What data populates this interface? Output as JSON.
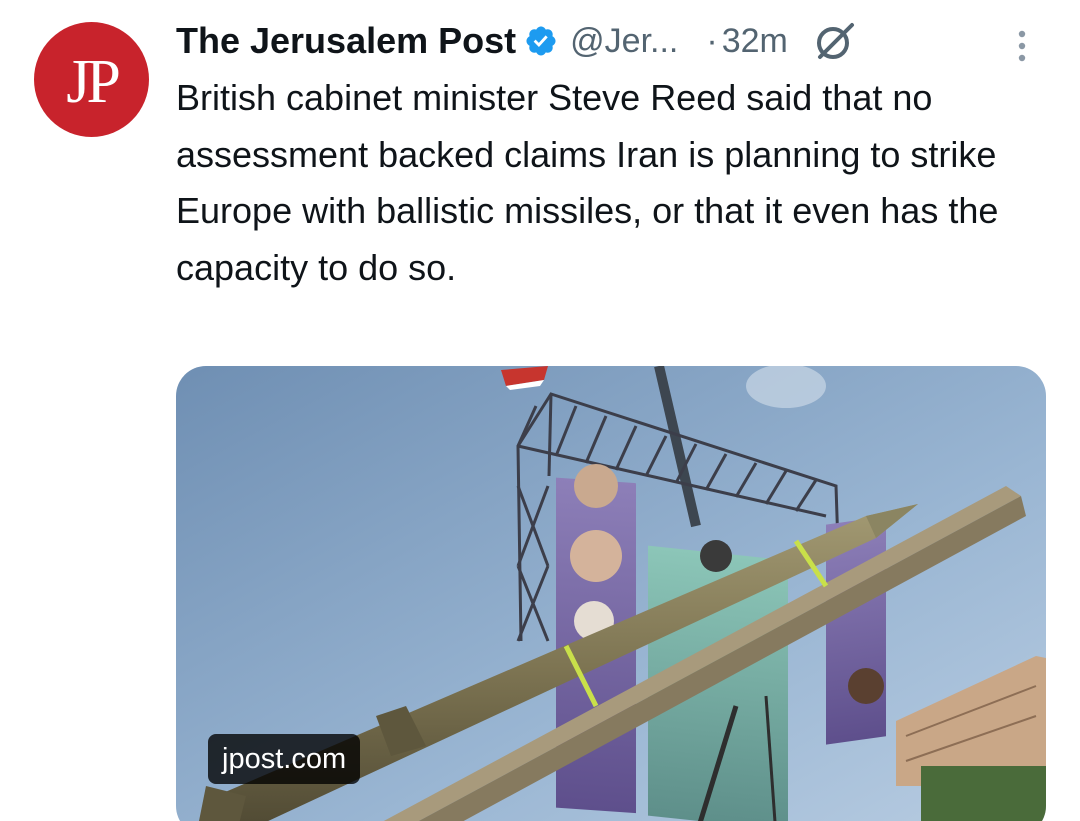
{
  "tweet": {
    "avatar_text": "JP",
    "display_name": "The Jerusalem Post",
    "handle": "@Jer...",
    "dot": "·",
    "time": "32m",
    "text": "British cabinet minister Steve Reed said that no assessment backed claims Iran is planning to strike Europe with ballistic missiles, or that it even has the capacity to do so.",
    "card": {
      "domain": "jpost.com"
    }
  },
  "colors": {
    "avatar_bg": "#c8232c",
    "verified": "#1d9bf0",
    "secondary_text": "#536471",
    "primary_text": "#0f1419"
  },
  "icons": {
    "verified": "verified-badge-icon",
    "grok": "grok-icon",
    "more": "more-vertical-icon"
  }
}
